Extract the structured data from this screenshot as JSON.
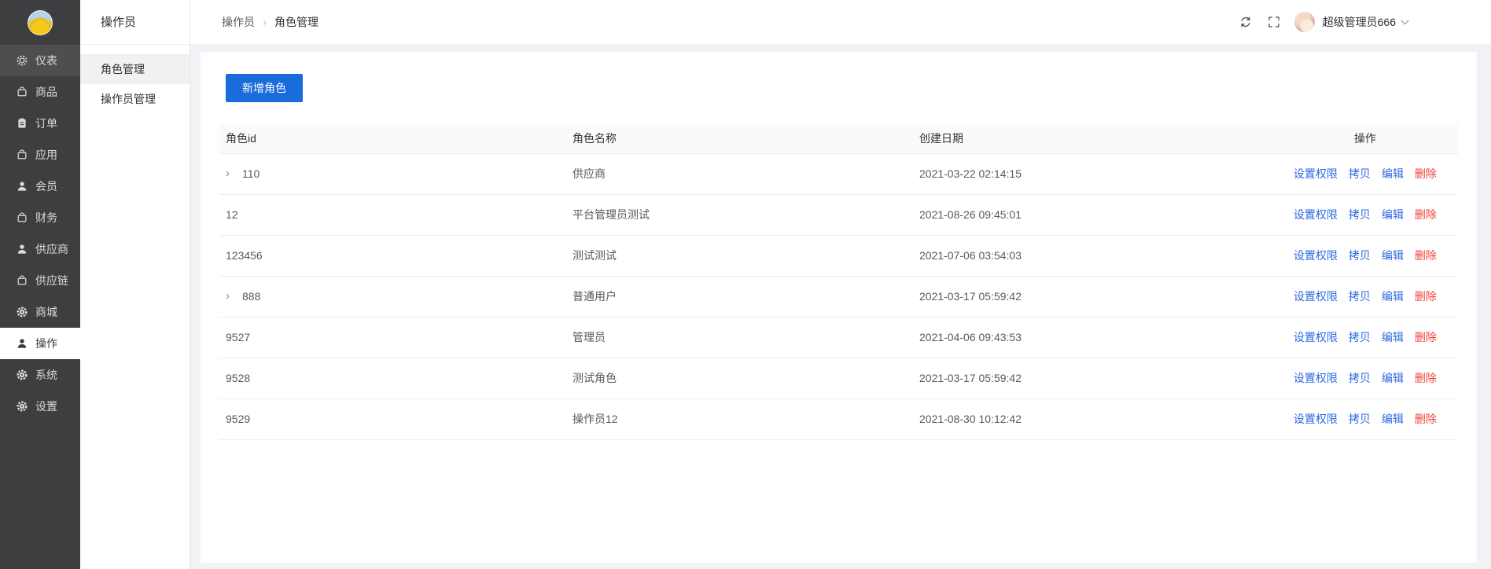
{
  "sidebar": {
    "items": [
      {
        "key": "dashboard",
        "label": "仪表",
        "icon": "gauge-icon",
        "state": "highlight"
      },
      {
        "key": "goods",
        "label": "商品",
        "icon": "bag-icon",
        "state": ""
      },
      {
        "key": "orders",
        "label": "订单",
        "icon": "clipboard-icon",
        "state": ""
      },
      {
        "key": "apps",
        "label": "应用",
        "icon": "bag-icon",
        "state": ""
      },
      {
        "key": "members",
        "label": "会员",
        "icon": "user-icon",
        "state": ""
      },
      {
        "key": "finance",
        "label": "财务",
        "icon": "bag-icon",
        "state": ""
      },
      {
        "key": "suppliers",
        "label": "供应商",
        "icon": "user-icon",
        "state": ""
      },
      {
        "key": "supply-chain",
        "label": "供应链",
        "icon": "bag-icon",
        "state": ""
      },
      {
        "key": "mall",
        "label": "商城",
        "icon": "gear-icon",
        "state": ""
      },
      {
        "key": "operations",
        "label": "操作",
        "icon": "user-icon",
        "state": "active"
      },
      {
        "key": "system",
        "label": "系统",
        "icon": "gear-icon",
        "state": ""
      },
      {
        "key": "settings",
        "label": "设置",
        "icon": "gear-icon",
        "state": ""
      }
    ]
  },
  "submenu": {
    "title": "操作员",
    "items": [
      {
        "key": "role-management",
        "label": "角色管理",
        "active": true
      },
      {
        "key": "operator-management",
        "label": "操作员管理",
        "active": false
      }
    ]
  },
  "breadcrumb": {
    "parent": "操作员",
    "separator": "›",
    "current": "角色管理"
  },
  "userbar": {
    "username": "超级管理员666"
  },
  "toolbar": {
    "add_button": "新增角色"
  },
  "table": {
    "columns": [
      "角色id",
      "角色名称",
      "创建日期",
      "操作"
    ],
    "actions": [
      "设置权限",
      "拷贝",
      "编辑",
      "删除"
    ],
    "rows": [
      {
        "id": "110",
        "expandable": true,
        "name": "供应商",
        "created": "2021-03-22 02:14:15"
      },
      {
        "id": "12",
        "expandable": false,
        "name": "平台管理员测试",
        "created": "2021-08-26 09:45:01"
      },
      {
        "id": "123456",
        "expandable": false,
        "name": "测试测试",
        "created": "2021-07-06 03:54:03"
      },
      {
        "id": "888",
        "expandable": true,
        "name": "普通用户",
        "created": "2021-03-17 05:59:42"
      },
      {
        "id": "9527",
        "expandable": false,
        "name": "管理员",
        "created": "2021-04-06 09:43:53"
      },
      {
        "id": "9528",
        "expandable": false,
        "name": "测试角色",
        "created": "2021-03-17 05:59:42"
      },
      {
        "id": "9529",
        "expandable": false,
        "name": "操作员12",
        "created": "2021-08-30 10:12:42"
      }
    ]
  },
  "colors": {
    "primary": "#1a6bdb",
    "link": "#2e6ae0",
    "danger": "#f0413d",
    "sidebar_bg": "#3e3e40",
    "sidebar_hover_bg": "#4e4e50",
    "main_bg": "#f0f2f5"
  }
}
